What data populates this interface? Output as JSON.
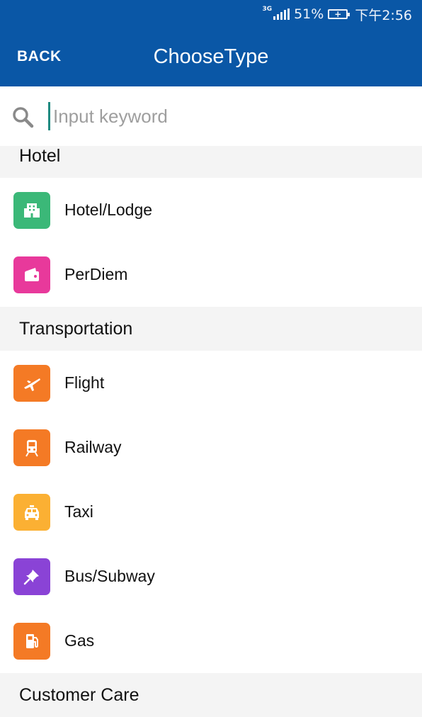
{
  "status_bar": {
    "network": "3G",
    "battery_percent": "51%",
    "time": "下午2:56"
  },
  "app_bar": {
    "back_label": "BACK",
    "title": "ChooseType"
  },
  "search": {
    "placeholder": "Input keyword",
    "value": ""
  },
  "sections": [
    {
      "title": "Hotel",
      "items": [
        {
          "label": "Hotel/Lodge",
          "icon": "building-icon",
          "color": "#3bb878"
        },
        {
          "label": "PerDiem",
          "icon": "wallet-icon",
          "color": "#e8399b"
        }
      ]
    },
    {
      "title": "Transportation",
      "items": [
        {
          "label": "Flight",
          "icon": "airplane-icon",
          "color": "#f47a25"
        },
        {
          "label": "Railway",
          "icon": "train-icon",
          "color": "#f47a25"
        },
        {
          "label": "Taxi",
          "icon": "taxi-icon",
          "color": "#fbb033"
        },
        {
          "label": "Bus/Subway",
          "icon": "pin-icon",
          "color": "#8a43d6"
        },
        {
          "label": "Gas",
          "icon": "gas-pump-icon",
          "color": "#f47a25"
        }
      ]
    },
    {
      "title": "Customer Care",
      "items": []
    }
  ],
  "colors": {
    "app_bar": "#0a57a6",
    "section_bg": "#f4f4f4",
    "cursor": "#1f8a80"
  }
}
